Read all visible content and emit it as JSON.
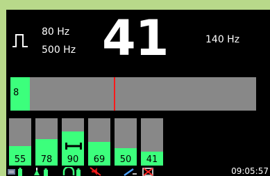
{
  "display": {
    "low_freq": "80 Hz",
    "high_freq": "500 Hz",
    "main_value": "41",
    "right_freq": "140 Hz"
  },
  "level_meter": {
    "value_label": "8",
    "fill_fraction": 0.08,
    "marker_fraction": 0.42
  },
  "channels": [
    {
      "label": "55",
      "fill_fraction": 0.41,
      "selected": false
    },
    {
      "label": "78",
      "fill_fraction": 0.56,
      "selected": false
    },
    {
      "label": "90",
      "fill_fraction": 0.72,
      "selected": true
    },
    {
      "label": "69",
      "fill_fraction": 0.5,
      "selected": false
    },
    {
      "label": "50",
      "fill_fraction": 0.37,
      "selected": false
    },
    {
      "label": "41",
      "fill_fraction": 0.3,
      "selected": false
    }
  ],
  "status": {
    "time": "09:05:57",
    "icons": [
      "monitor-battery-icon",
      "sensor-battery-icon",
      "headset-battery-icon",
      "muted-speaker-icon",
      "sync-icon",
      "alarm-off-icon"
    ]
  },
  "colors": {
    "accent": "#3cff7c",
    "marker": "#ff1a1a",
    "track": "#888888",
    "background": "#000000",
    "frame": "#b8d98a"
  }
}
